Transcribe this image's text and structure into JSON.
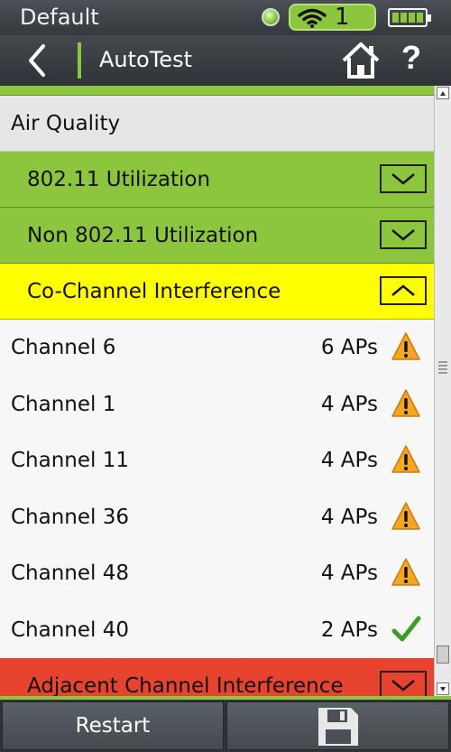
{
  "status_bar": {
    "profile": "Default",
    "wifi_count": "1",
    "battery_cells": 4,
    "link_status_color": "#8cc63f"
  },
  "title_bar": {
    "title": "AutoTest",
    "help_label": "?"
  },
  "section": {
    "title": "Air Quality"
  },
  "groups": [
    {
      "label": "802.11 Utilization",
      "status": "pass",
      "color": "#8cc63f",
      "expanded": false
    },
    {
      "label": "Non 802.11 Utilization",
      "status": "pass",
      "color": "#8cc63f",
      "expanded": false
    },
    {
      "label": "Co-Channel Interference",
      "status": "warning",
      "color": "#ffff00",
      "expanded": true
    },
    {
      "label": "Adjacent Channel Interference",
      "status": "fail",
      "color": "#e8432f",
      "expanded": false
    }
  ],
  "channels": [
    {
      "label": "Channel 6",
      "count": "6 APs",
      "icon": "warning-icon"
    },
    {
      "label": "Channel 1",
      "count": "4 APs",
      "icon": "warning-icon"
    },
    {
      "label": "Channel 11",
      "count": "4 APs",
      "icon": "warning-icon"
    },
    {
      "label": "Channel 36",
      "count": "4 APs",
      "icon": "warning-icon"
    },
    {
      "label": "Channel 48",
      "count": "4 APs",
      "icon": "warning-icon"
    },
    {
      "label": "Channel 40",
      "count": "2 APs",
      "icon": "checkmark-icon"
    }
  ],
  "bottom_bar": {
    "restart_label": "Restart",
    "save_icon": "save-icon"
  }
}
